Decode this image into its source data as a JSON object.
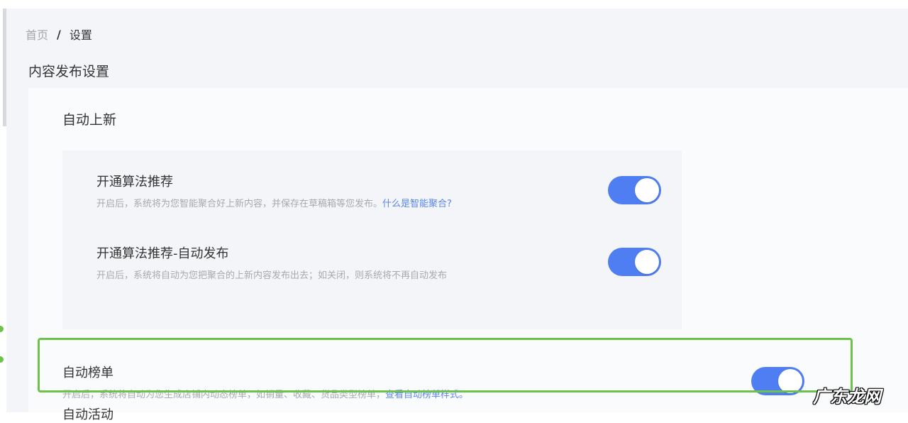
{
  "breadcrumb": {
    "home": "首页",
    "separator": "/",
    "current": "设置"
  },
  "page_title": "内容发布设置",
  "section_auto_new": {
    "title": "自动上新",
    "items": [
      {
        "title": "开通算法推荐",
        "desc": "开启后，系统将为您智能聚合好上新内容，并保存在草稿箱等您发布。",
        "link": "什么是智能聚合?",
        "enabled": true
      },
      {
        "title": "开通算法推荐-自动发布",
        "desc": "开启后，系统将自动为您把聚合的上新内容发布出去；如关闭，则系统将不再自动发布",
        "enabled": true
      }
    ]
  },
  "auto_ranking": {
    "title": "自动榜单",
    "desc": "开启后，系统将自动为您生成店铺内动态榜单，如销量、收藏、货品类型榜单，",
    "link": "查看自动榜单样式。",
    "enabled": true
  },
  "next_section_partial": "自动活动",
  "watermark": "广东龙网",
  "colors": {
    "toggle_on": "#4f7ef3",
    "link": "#5b86ee",
    "highlight": "#6dc24b"
  }
}
